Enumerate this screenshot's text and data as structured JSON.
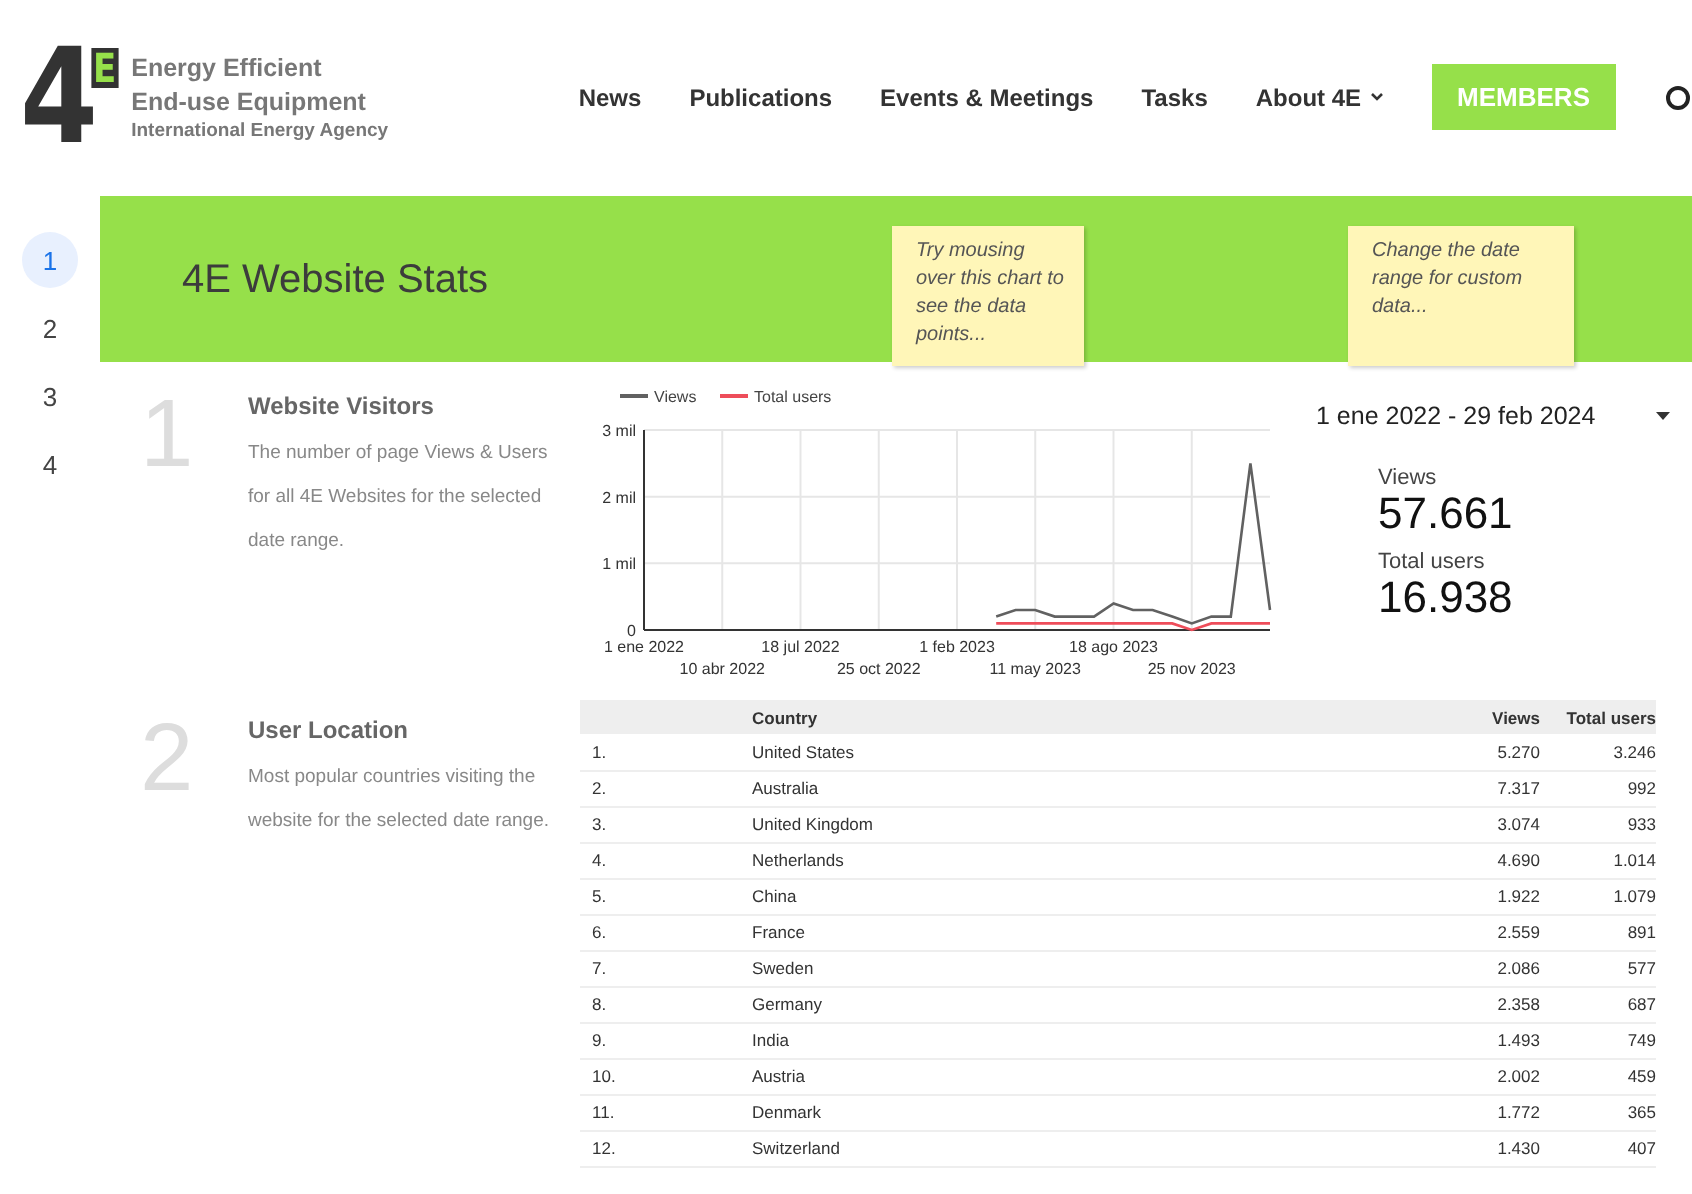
{
  "header": {
    "logo_mark": "4",
    "logo_mark_small": "E",
    "org_line_1": "Energy Efficient",
    "org_line_2": "End-use Equipment",
    "org_line_3": "International Energy Agency",
    "nav": [
      {
        "label": "News",
        "kind": "link"
      },
      {
        "label": "Publications",
        "kind": "link"
      },
      {
        "label": "Events & Meetings",
        "kind": "link"
      },
      {
        "label": "Tasks",
        "kind": "link"
      },
      {
        "label": "About 4E",
        "kind": "dropdown"
      },
      {
        "label": "MEMBERS",
        "kind": "button"
      }
    ]
  },
  "page_nav": [
    {
      "label": "1",
      "selected": true
    },
    {
      "label": "2",
      "selected": false
    },
    {
      "label": "3",
      "selected": false
    },
    {
      "label": "4",
      "selected": false
    }
  ],
  "banner": {
    "title": "4E Website Stats",
    "notes": [
      "Try mousing over this chart to see the data points...",
      "Change the date range for custom data..."
    ]
  },
  "sections": [
    {
      "number": "1",
      "title": "Website Visitors",
      "description": "The number of page Views & Users for all 4E Websites for the selected date range."
    },
    {
      "number": "2",
      "title": "User Location",
      "description": "Most popular countries visiting the website for the selected date range."
    }
  ],
  "visitors": {
    "date_range": "1 ene 2022 - 29 feb 2024",
    "metrics": [
      {
        "label": "Views",
        "value": "57.661"
      },
      {
        "label": "Total users",
        "value": "16.938"
      }
    ],
    "chart_data": {
      "type": "line",
      "grid": true,
      "legend": "top",
      "categories": [
        "1 ene 2022",
        null,
        null,
        null,
        "10 abr 2022",
        null,
        null,
        null,
        "18 jul 2022",
        null,
        null,
        null,
        "25 oct 2022",
        null,
        null,
        null,
        "1 feb 2023",
        null,
        null,
        null,
        "11 may 2023",
        null,
        null,
        null,
        "18 ago 2023",
        null,
        null,
        null,
        "25 nov 2023",
        null,
        null,
        null,
        null
      ],
      "series": [
        {
          "name": "Views",
          "color": "#616161",
          "values": [
            null,
            null,
            null,
            null,
            null,
            null,
            null,
            null,
            null,
            null,
            null,
            null,
            null,
            null,
            null,
            null,
            null,
            null,
            0.2,
            0.3,
            0.3,
            0.2,
            0.2,
            0.2,
            0.4,
            0.3,
            0.3,
            0.2,
            0.1,
            0.2,
            0.2,
            2.5,
            0.3
          ]
        },
        {
          "name": "Total users",
          "color": "#ee4d5a",
          "values": [
            null,
            null,
            null,
            null,
            null,
            null,
            null,
            null,
            null,
            null,
            null,
            null,
            null,
            null,
            null,
            null,
            null,
            null,
            0.1,
            0.1,
            0.1,
            0.1,
            0.1,
            0.1,
            0.1,
            0.1,
            0.1,
            0.1,
            0.0,
            0.1,
            0.1,
            0.1,
            0.1
          ]
        }
      ],
      "ylim": [
        0,
        3
      ],
      "yticks": [
        {
          "value": 0,
          "label": "0"
        },
        {
          "value": 1,
          "label": "1 mil"
        },
        {
          "value": 2,
          "label": "2 mil"
        },
        {
          "value": 3,
          "label": "3 mil"
        }
      ]
    }
  },
  "countries": {
    "columns": [
      "",
      "Country",
      "Views",
      "Total users"
    ],
    "rows": [
      [
        "1.",
        "United States",
        "5.270",
        "3.246"
      ],
      [
        "2.",
        "Australia",
        "7.317",
        "992"
      ],
      [
        "3.",
        "United Kingdom",
        "3.074",
        "933"
      ],
      [
        "4.",
        "Netherlands",
        "4.690",
        "1.014"
      ],
      [
        "5.",
        "China",
        "1.922",
        "1.079"
      ],
      [
        "6.",
        "France",
        "2.559",
        "891"
      ],
      [
        "7.",
        "Sweden",
        "2.086",
        "577"
      ],
      [
        "8.",
        "Germany",
        "2.358",
        "687"
      ],
      [
        "9.",
        "India",
        "1.493",
        "749"
      ],
      [
        "10.",
        "Austria",
        "2.002",
        "459"
      ],
      [
        "11.",
        "Denmark",
        "1.772",
        "365"
      ],
      [
        "12.",
        "Switzerland",
        "1.430",
        "407"
      ]
    ]
  }
}
